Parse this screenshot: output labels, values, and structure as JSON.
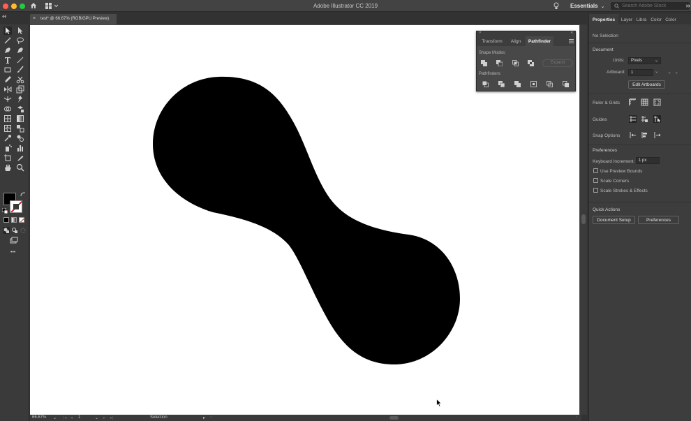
{
  "app": {
    "title": "Adobe Illustrator CC 2019"
  },
  "header": {
    "workspace_label": "Essentials",
    "search_placeholder": "Search Adobe Stock"
  },
  "document_tab": {
    "close": "×",
    "title": "test* @ 66.67% (RGB/GPU Preview)"
  },
  "toolbar": {
    "more": "•••"
  },
  "statusbar": {
    "zoom": "66.67%",
    "artboard_number": "1",
    "tool_name": "Selection"
  },
  "pathfinder_panel": {
    "tabs": [
      {
        "label": "Transform",
        "active": false
      },
      {
        "label": "Align",
        "active": false
      },
      {
        "label": "Pathfinder",
        "active": true
      }
    ],
    "shape_modes_label": "Shape Modes:",
    "pathfinders_label": "Pathfinders:",
    "expand_label": "Expand",
    "close": "×",
    "collapse": "«"
  },
  "properties_panel": {
    "tabs": [
      {
        "label": "Properties",
        "active": true
      },
      {
        "label": "Layer",
        "active": false
      },
      {
        "label": "Libra",
        "active": false
      },
      {
        "label": "Color",
        "active": false
      },
      {
        "label": "Color",
        "active": false
      }
    ],
    "selection_status": "No Selection",
    "document_section": "Document",
    "units_label": "Units:",
    "units_value": "Pixels",
    "artboard_label": "Artboard:",
    "artboard_value": "1",
    "edit_artboards_label": "Edit Artboards",
    "ruler_grids_label": "Ruler & Grids",
    "guides_label": "Guides",
    "snap_options_label": "Snap Options",
    "preferences_section": "Preferences",
    "keyboard_increment_label": "Keyboard Increment:",
    "keyboard_increment_value": "1 px",
    "checkboxes": [
      {
        "label": "Use Preview Bounds",
        "checked": false
      },
      {
        "label": "Scale Corners",
        "checked": false
      },
      {
        "label": "Scale Strokes & Effects",
        "checked": false
      }
    ],
    "quick_actions_section": "Quick Actions",
    "document_setup_label": "Document Setup",
    "preferences_button_label": "Preferences"
  },
  "colors": {
    "fill": "#000000",
    "stroke": "#ffffff",
    "accent": "#3a3a3a"
  }
}
